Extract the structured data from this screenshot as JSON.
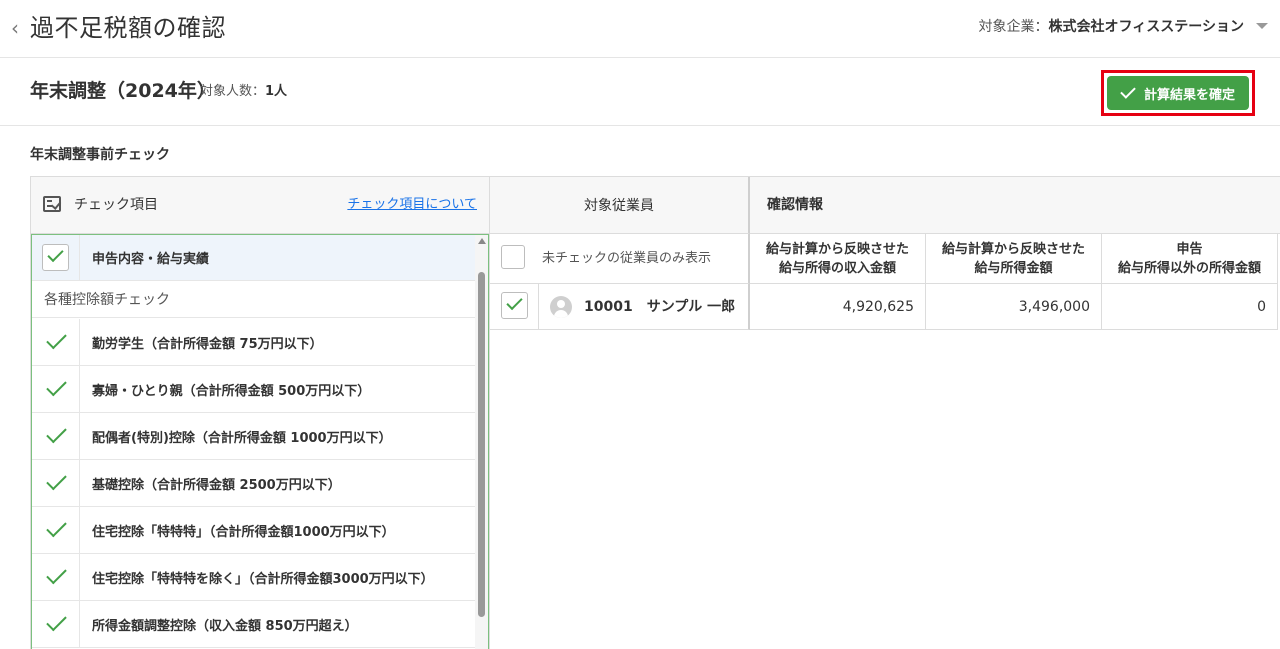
{
  "header": {
    "title": "過不足税額の確認",
    "company_label": "対象企業：",
    "company_name": "株式会社オフィスステーション"
  },
  "subheader": {
    "year_title": "年末調整（2024年）",
    "target_label": "対象人数：",
    "target_count": "1人",
    "confirm_button": "計算結果を確定"
  },
  "section_title": "年末調整事前チェック",
  "check_panel": {
    "header_label": "チェック項目",
    "about_link": "チェック項目について",
    "first_item": {
      "label": "申告内容・給与実績",
      "checked": true
    },
    "group_label": "各種控除額チェック",
    "items": [
      {
        "label": "勤労学生（合計所得金額 75万円以下）",
        "checked": true
      },
      {
        "label": "寡婦・ひとり親（合計所得金額 500万円以下）",
        "checked": true
      },
      {
        "label": "配偶者(特別)控除（合計所得金額 1000万円以下）",
        "checked": true
      },
      {
        "label": "基礎控除（合計所得金額 2500万円以下）",
        "checked": true
      },
      {
        "label": "住宅控除「特特特」（合計所得金額1000万円以下）",
        "checked": true
      },
      {
        "label": "住宅控除「特特特を除く」（合計所得金額3000万円以下）",
        "checked": true
      },
      {
        "label": "所得金額調整控除（収入金額 850万円超え）",
        "checked": true
      }
    ]
  },
  "employee_panel": {
    "header_label": "対象従業員",
    "filter_label": "未チェックの従業員のみ表示",
    "filter_checked": false,
    "employees": [
      {
        "id_name": "10001　サンプル 一郎",
        "checked": true
      }
    ]
  },
  "info_panel": {
    "header_label": "確認情報",
    "columns": [
      {
        "line1": "給与計算から反映させた",
        "line2": "給与所得の収入金額"
      },
      {
        "line1": "給与計算から反映させた",
        "line2": "給与所得金額"
      },
      {
        "line1": "申告",
        "line2": "給与所得以外の所得金額"
      }
    ],
    "rows": [
      [
        "4,920,625",
        "3,496,000",
        "0"
      ]
    ]
  },
  "colors": {
    "accent_green": "#43a047",
    "highlight_red": "#e60012",
    "link_blue": "#1a73e8"
  }
}
